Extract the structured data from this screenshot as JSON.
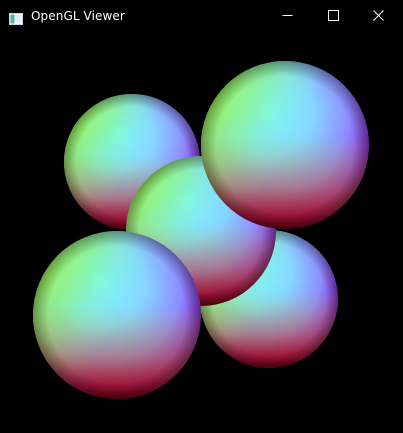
{
  "window": {
    "title": "OpenGL Viewer",
    "icons": {
      "app": "app-window-icon",
      "minimize": "minimize-icon",
      "maximize": "maximize-icon",
      "close": "close-icon"
    }
  },
  "scene": {
    "background": "#000000",
    "object_count": 5,
    "object_type": "sphere",
    "shading": "normal-color",
    "palette": {
      "light": "#7ff0ff",
      "green": "#90ff40",
      "blue": "#8a7cff",
      "magenta": "#9a1ec8",
      "red": "#7a0010"
    }
  }
}
